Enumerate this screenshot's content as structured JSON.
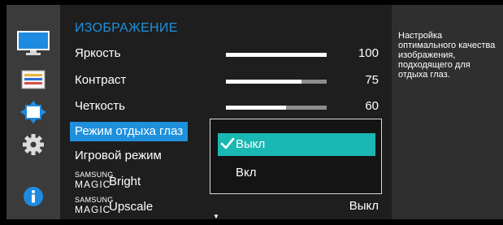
{
  "menu": {
    "title": "ИЗОБРАЖЕНИЕ",
    "items": [
      {
        "label": "Яркость",
        "value": "100",
        "level": 100
      },
      {
        "label": "Контраст",
        "value": "75",
        "level": 75
      },
      {
        "label": "Четкость",
        "value": "60",
        "level": 60
      },
      {
        "label": "Режим отдыха глаз"
      },
      {
        "label": "Игровой режим"
      },
      {
        "brand": "SAMSUNG",
        "magic": "MAGIC",
        "label": "Bright"
      },
      {
        "brand": "SAMSUNG",
        "magic": "MAGIC",
        "label": "Upscale",
        "value": "Выкл"
      }
    ],
    "selected_index": 3,
    "scroll_indicator": "▼"
  },
  "dropdown": {
    "options": [
      {
        "label": "Выкл",
        "selected": true
      },
      {
        "label": "Вкл",
        "selected": false
      }
    ]
  },
  "help": {
    "text": "Настройка оптимального качества изображения, подходящего для отдыха глаз."
  },
  "icons": [
    "picture-icon",
    "onscreen-display-icon",
    "position-size-icon",
    "settings-gear-icon",
    "information-icon"
  ],
  "colors": {
    "accent_blue": "#1f90dc",
    "active_option": "#1bb8b3",
    "panel_bg": "#1e1e1e",
    "rail_bg": "#3b3b3b",
    "help_bg": "#2f2f2f"
  }
}
